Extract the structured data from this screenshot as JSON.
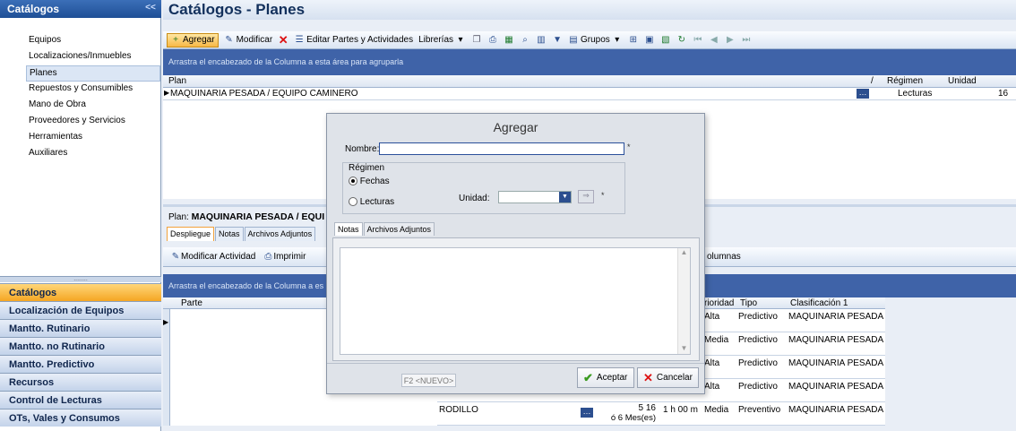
{
  "sidebar": {
    "header": "Catálogos",
    "collapse": "<<",
    "items": [
      {
        "label": "Equipos"
      },
      {
        "label": "Localizaciones/Inmuebles"
      },
      {
        "label": "Planes"
      },
      {
        "label": "Repuestos y Consumibles"
      },
      {
        "label": "Mano de Obra"
      },
      {
        "label": "Proveedores y Servicios"
      },
      {
        "label": "Herramientas"
      },
      {
        "label": "Auxiliares"
      }
    ],
    "nav": [
      {
        "label": "Catálogos"
      },
      {
        "label": "Localización de Equipos"
      },
      {
        "label": "Mantto. Rutinario"
      },
      {
        "label": "Mantto. no Rutinario"
      },
      {
        "label": "Mantto. Predictivo"
      },
      {
        "label": "Recursos"
      },
      {
        "label": "Control de Lecturas"
      },
      {
        "label": "OTs, Vales y Consumos"
      }
    ]
  },
  "main": {
    "title": "Catálogos - Planes",
    "toolbar": {
      "agregar": "Agregar",
      "modificar": "Modificar",
      "editar": "Editar Partes y Actividades",
      "librerias": "Librerías",
      "grupos": "Grupos"
    },
    "group_hint": "Arrastra el encabezado de la Columna a esta área para agruparla",
    "grid": {
      "headers": [
        "Plan",
        "Régimen",
        "Unidad"
      ],
      "rows": [
        {
          "plan": "MAQUINARIA PESADA / EQUIPO CAMINERO",
          "regimen": "Lecturas",
          "unidad": "16"
        }
      ]
    },
    "plan_label_prefix": "Plan:",
    "plan_label_value": "MAQUINARIA PESADA / EQUI",
    "lower_tabs": [
      "Despliegue",
      "Notas",
      "Archivos Adjuntos"
    ],
    "lower_toolbar": {
      "modificar": "Modificar Actividad",
      "imprimir": "Imprimir",
      "columnas": "olumnas"
    },
    "lower_group_hint": "Arrastra el encabezado de la Columna a es",
    "lower_grid": {
      "headers": {
        "parte": "Parte",
        "prioridad": "rioridad",
        "tipo": "Tipo",
        "clasificacion": "Clasificación 1"
      },
      "rows": [
        {
          "parte": "",
          "desc": "",
          "freq": "",
          "tiempo": "",
          "prioridad": "Alta",
          "tipo": "Predictivo",
          "clasificacion": "MAQUINARIA PESADA"
        },
        {
          "parte": "",
          "desc": "",
          "freq": "",
          "tiempo": "",
          "prioridad": "Media",
          "tipo": "Predictivo",
          "clasificacion": "MAQUINARIA PESADA"
        },
        {
          "parte": "",
          "desc": "",
          "freq": "",
          "tiempo": "",
          "prioridad": "Alta",
          "tipo": "Predictivo",
          "clasificacion": "MAQUINARIA PESADA"
        },
        {
          "parte": "",
          "desc": "",
          "freq": "",
          "tiempo": "",
          "prioridad": "Alta",
          "tipo": "Predictivo",
          "clasificacion": "MAQUINARIA PESADA"
        },
        {
          "parte": "RODILLO",
          "desc": "",
          "freq_a": "5 16",
          "freq_b": "ó 6 Mes(es)",
          "tiempo": "1 h 00 m",
          "prioridad": "Media",
          "tipo": "Preventivo",
          "clasificacion": "MAQUINARIA PESADA"
        }
      ]
    }
  },
  "dialog": {
    "title": "Agregar",
    "nombre_label": "Nombre:",
    "nombre_value": "",
    "required_mark": "*",
    "regimen_label": "Régimen",
    "fechas": "Fechas",
    "lecturas": "Lecturas",
    "selected_regimen": "Fechas",
    "unidad_label": "Unidad:",
    "unidad_value": "",
    "tabs": [
      "Notas",
      "Archivos Adjuntos"
    ],
    "nuevo": "F2 <NUEVO>",
    "aceptar": "Aceptar",
    "cancelar": "Cancelar"
  }
}
